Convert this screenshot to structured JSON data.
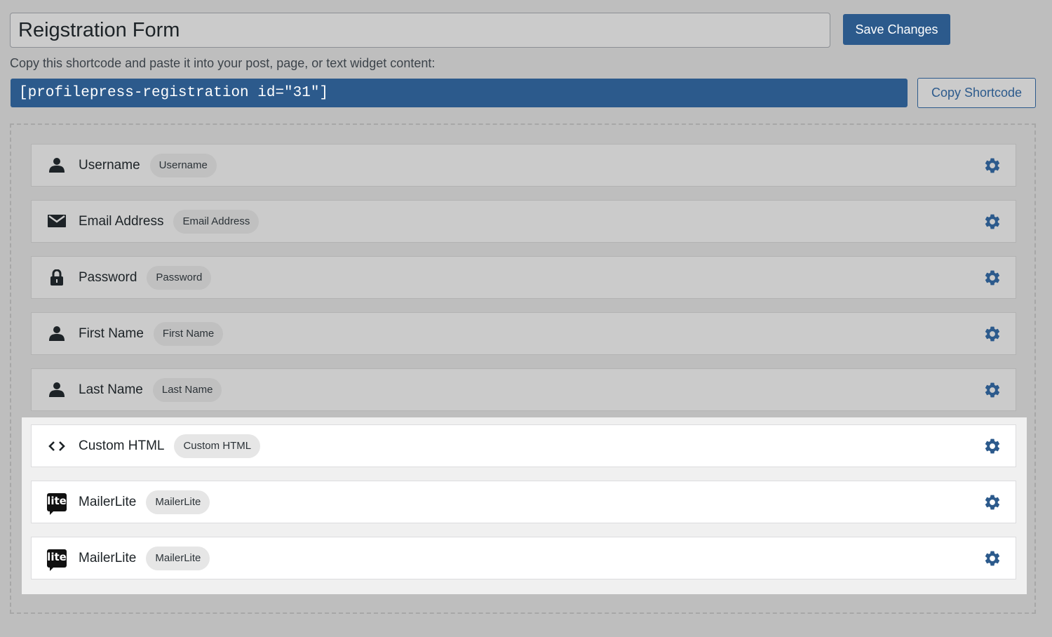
{
  "form": {
    "title_value": "Reigstration Form",
    "save_label": "Save Changes",
    "instructions": "Copy this shortcode and paste it into your post, page, or text widget content:",
    "shortcode": "[profilepress-registration id=\"31\"]",
    "copy_label": "Copy Shortcode"
  },
  "fields": [
    {
      "label": "Username",
      "badge": "Username",
      "icon": "user-icon"
    },
    {
      "label": "Email Address",
      "badge": "Email Address",
      "icon": "envelope-icon"
    },
    {
      "label": "Password",
      "badge": "Password",
      "icon": "lock-icon"
    },
    {
      "label": "First Name",
      "badge": "First Name",
      "icon": "user-icon"
    },
    {
      "label": "Last Name",
      "badge": "Last Name",
      "icon": "user-icon"
    },
    {
      "label": "Custom HTML",
      "badge": "Custom HTML",
      "icon": "code-icon"
    },
    {
      "label": "MailerLite",
      "badge": "MailerLite",
      "icon": "mailerlite-logo-icon",
      "logo_text": "lite"
    },
    {
      "label": "MailerLite",
      "badge": "MailerLite",
      "icon": "mailerlite-logo-icon",
      "logo_text": "lite"
    }
  ],
  "colors": {
    "primary": "#2c5a8c",
    "overlay_background": "#bebebe",
    "active_row_background": "#ffffff"
  }
}
